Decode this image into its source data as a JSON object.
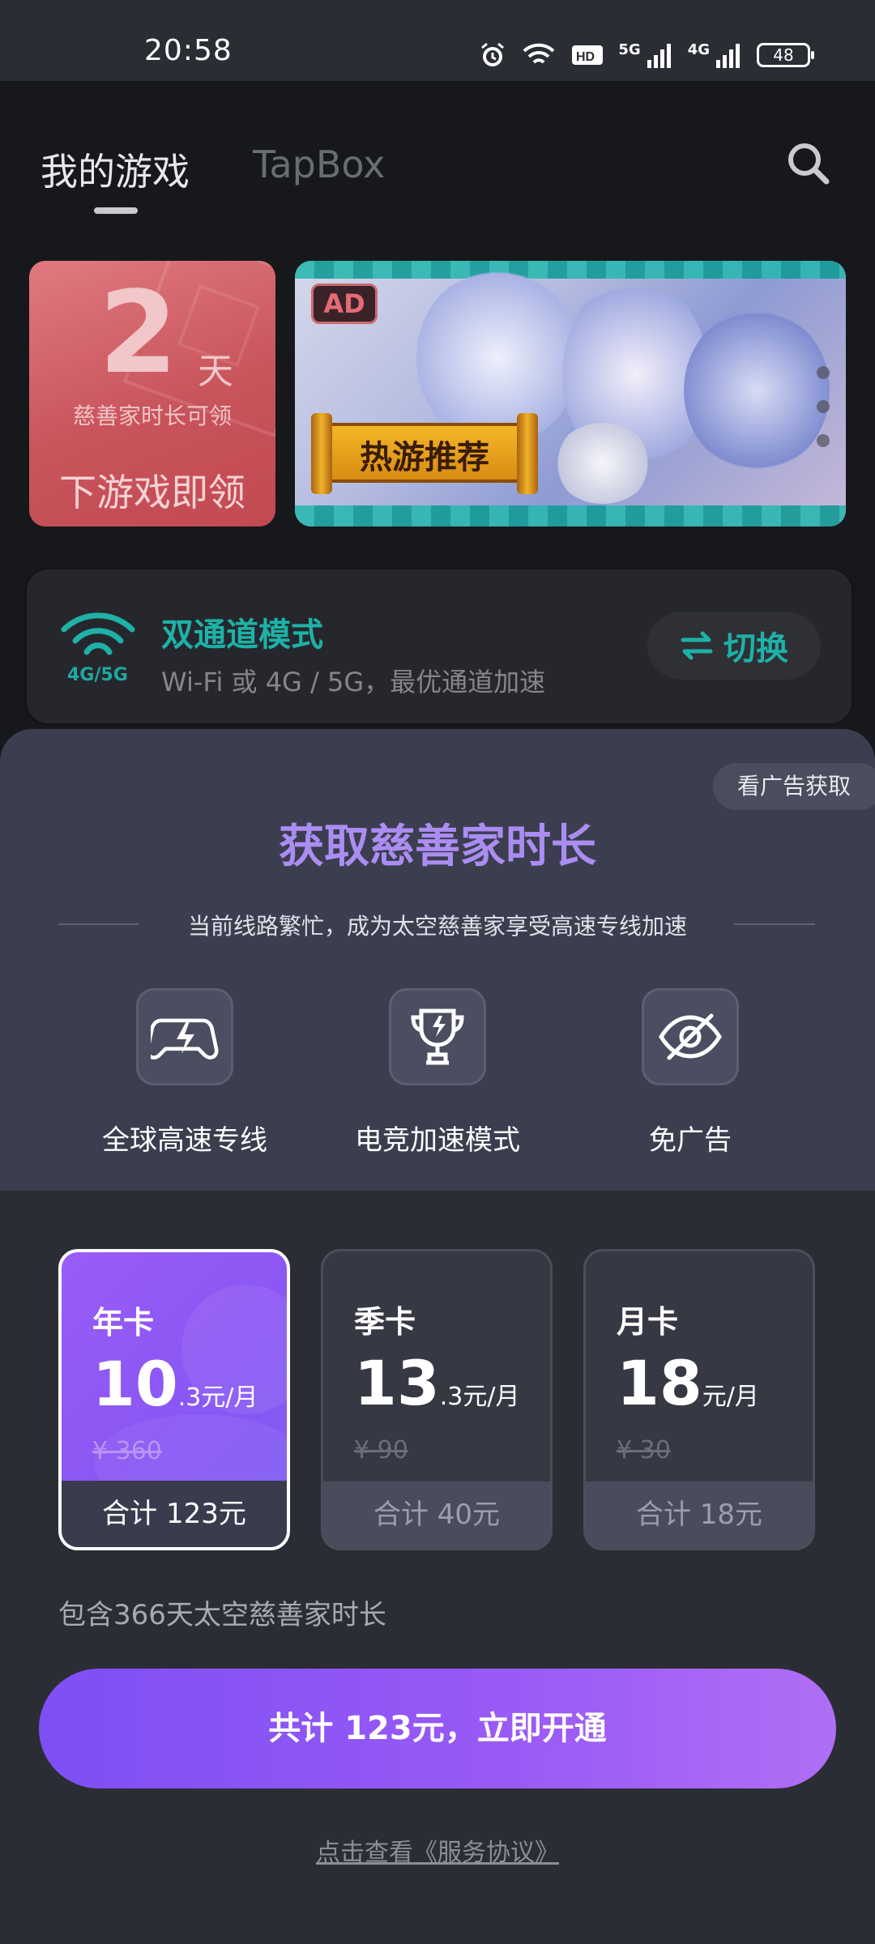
{
  "status_bar": {
    "time": "20:58",
    "network_1": "5G",
    "network_2": "4G",
    "battery": "48"
  },
  "header": {
    "tab_active": "我的游戏",
    "tab_inactive": "TapBox"
  },
  "promo": {
    "days": "2",
    "days_unit": "天",
    "sub": "慈善家时长可领",
    "cta": "下游戏即领",
    "ad_badge": "AD",
    "banner_text": "热游推荐"
  },
  "dual_channel": {
    "icon_label": "4G/5G",
    "title": "双通道模式",
    "description": "Wi-Fi 或 4G / 5G，最优通道加速",
    "switch_label": "切换"
  },
  "sheet": {
    "watch_ad": "看广告获取",
    "title": "获取慈善家时长",
    "subtitle": "当前线路繁忙，成为太空慈善家享受高速专线加速",
    "features": [
      {
        "label": "全球高速专线",
        "icon": "gamepad-lightning-icon"
      },
      {
        "label": "电竞加速模式",
        "icon": "trophy-icon"
      },
      {
        "label": "免广告",
        "icon": "eye-off-icon"
      }
    ],
    "plans": [
      {
        "name": "年卡",
        "price_main": "10",
        "price_suffix": ".3元/月",
        "original": "¥ 360",
        "total": "合计 123元",
        "selected": true
      },
      {
        "name": "季卡",
        "price_main": "13",
        "price_suffix": ".3元/月",
        "original": "¥ 90",
        "total": "合计 40元",
        "selected": false
      },
      {
        "name": "月卡",
        "price_main": "18",
        "price_suffix": "元/月",
        "original": "¥ 30",
        "total": "合计 18元",
        "selected": false
      }
    ],
    "includes": "包含366天太空慈善家时长",
    "buy_button": "共计 123元，立即开通",
    "agreement": "点击查看《服务协议》"
  },
  "colors": {
    "accent_purple": "#9a5cf6",
    "teal": "#1eb1a7",
    "title_purple": "#ab8df2"
  }
}
